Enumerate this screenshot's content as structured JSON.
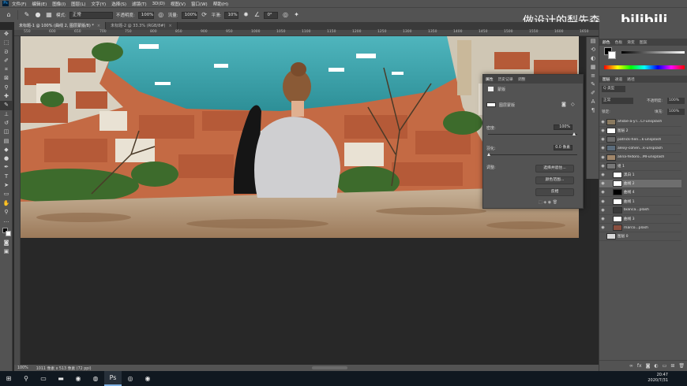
{
  "menu": [
    "文件(F)",
    "编辑(E)",
    "图像(I)",
    "图层(L)",
    "文字(Y)",
    "选择(S)",
    "滤镜(T)",
    "3D(D)",
    "视图(V)",
    "窗口(W)",
    "帮助(H)"
  ],
  "options": {
    "mode_label": "模式:",
    "mode_value": "正常",
    "opacity_label": "不透明度:",
    "opacity_value": "100%",
    "flow_label": "流量:",
    "flow_value": "100%",
    "smooth_label": "平滑:",
    "smooth_value": "10%",
    "angle_value": "0°"
  },
  "tabs": [
    {
      "label": "未标题-1 @ 100% (曲线 2, 图层蒙版/8) *"
    },
    {
      "label": "未标题-2 @ 33.3% (RGB/8#)"
    }
  ],
  "ruler_ticks": [
    "550",
    "600",
    "650",
    "700",
    "750",
    "800",
    "850",
    "900",
    "950",
    "1000",
    "1050",
    "1100",
    "1150",
    "1200",
    "1250",
    "1300",
    "1350",
    "1400",
    "1450",
    "1500",
    "1550",
    "1600",
    "1650"
  ],
  "status": {
    "zoom": "100%",
    "doc": "1011 像素 x 513 像素 (72 ppi)"
  },
  "properties": {
    "tabs": [
      "属性",
      "历史记录",
      "调整"
    ],
    "header": "蒙版",
    "mask_label": "图层蒙版",
    "density_label": "密度:",
    "density_value": "100%",
    "feather_label": "羽化:",
    "feather_value": "0.0 像素",
    "adjust_label": "调整:",
    "btn_select": "选择并遮住...",
    "btn_color": "颜色范围...",
    "btn_invert": "反相"
  },
  "layers_panel": {
    "tabs_top": [
      "颜色",
      "色板",
      "渐变",
      "图案"
    ],
    "tabs": [
      "图层",
      "通道",
      "路径"
    ],
    "kind": "Q 类型",
    "blend": "正常",
    "opacity_label": "不透明度:",
    "opacity": "100%",
    "fill_label": "填充:",
    "fill": "100%",
    "lock_label": "锁定:",
    "items": [
      {
        "name": "ahsbe-a-yT...Cr-unsplash",
        "thumb": "#8a7a60"
      },
      {
        "name": "图层 2",
        "thumb": "#ffffff"
      },
      {
        "name": "patrick-hen...k-unsplash",
        "thumb": "#6b6b6b"
      },
      {
        "name": "alexy-cohen...k-unsplash",
        "thumb": "#5b6c7c"
      },
      {
        "name": "alina-fedoro...MI-unsplash",
        "thumb": "#a0866a"
      },
      {
        "name": "组 1",
        "thumb": "#777777"
      },
      {
        "name": "黑白 1",
        "thumb": "#ffffff"
      },
      {
        "name": "曲线 2",
        "thumb": "#ffffff"
      },
      {
        "name": "曲线 4",
        "thumb": "#000000"
      },
      {
        "name": "曲线 1",
        "thumb": "#ffffff"
      },
      {
        "name": "bianca...plash",
        "thumb": "#3a3a3a"
      },
      {
        "name": "曲线 3",
        "thumb": "#ffffff"
      },
      {
        "name": "marco...plash",
        "thumb": "#8a5040"
      },
      {
        "name": "图层 0",
        "thumb": "#d8d8d8"
      }
    ]
  },
  "watermark": {
    "text": "做设计的梨先森",
    "logo": "bilibili"
  },
  "clock": {
    "time": "20:47",
    "date": "2020/7/31"
  },
  "colors": {
    "ps_panel": "#535353",
    "ps_bg": "#282828",
    "taskbar": "#101820",
    "sea": "#3aa6ad"
  }
}
